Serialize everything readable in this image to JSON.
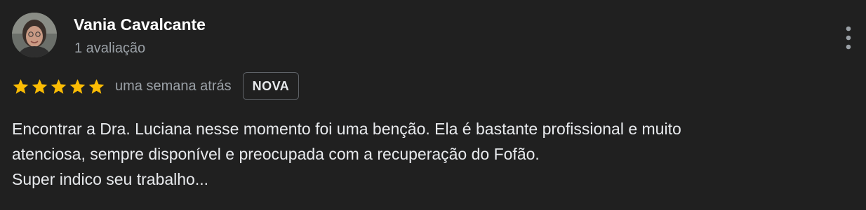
{
  "review": {
    "author_name": "Vania Cavalcante",
    "author_meta": "1 avaliação",
    "rating": 5,
    "rating_max": 5,
    "timestamp": "uma semana atrás",
    "badge": "NOVA",
    "text_lines": [
      "Encontrar a Dra. Luciana nesse momento foi uma benção. Ela é bastante profissional e muito",
      "atenciosa, sempre disponível e preocupada com a recuperação do Fofão.",
      "Super indico seu trabalho..."
    ]
  },
  "icons": {
    "avatar": "avatar-photo",
    "star": "star-icon",
    "more": "more-vert-icon"
  },
  "colors": {
    "background": "#202020",
    "star": "#fbbc04",
    "secondary_text": "#9aa0a6"
  }
}
